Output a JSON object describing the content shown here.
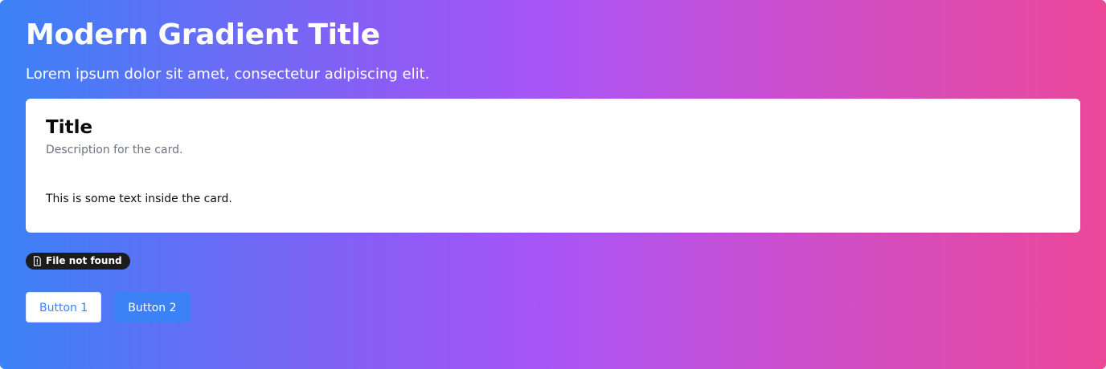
{
  "header": {
    "title": "Modern Gradient Title",
    "subtitle": "Lorem ipsum dolor sit amet, consectetur adipiscing elit."
  },
  "card": {
    "title": "Title",
    "description": "Description for the card.",
    "body": "This is some text inside the card."
  },
  "badge": {
    "icon": "file-alert-icon",
    "label": "File not found"
  },
  "buttons": [
    {
      "label": "Button 1"
    },
    {
      "label": "Button 2"
    }
  ],
  "colors": {
    "gradient_start": "#3b82f6",
    "gradient_mid": "#a855f7",
    "gradient_end": "#ec4899",
    "primary_button_text": "#3b82f6",
    "secondary_button_bg": "#3b82f6",
    "badge_bg": "#1c1c1c"
  }
}
